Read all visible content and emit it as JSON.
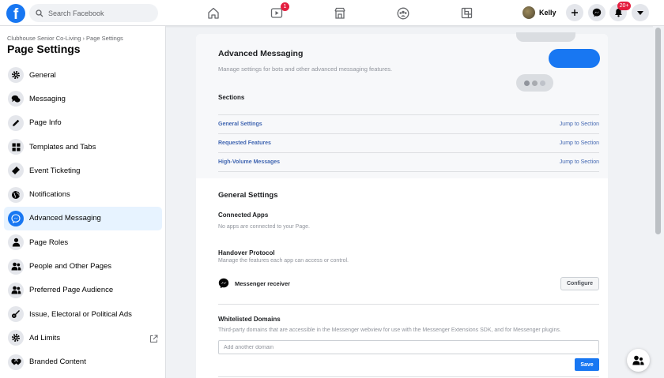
{
  "header": {
    "search_placeholder": "Search Facebook",
    "watch_badge": "1",
    "profile_name": "Kelly",
    "notifications_badge": "20+"
  },
  "sidebar": {
    "breadcrumb": "Clubhouse Senior Co-Living › Page Settings",
    "title": "Page Settings",
    "items": [
      {
        "label": "General",
        "icon": "gear-icon"
      },
      {
        "label": "Messaging",
        "icon": "chat-bubbles-icon"
      },
      {
        "label": "Page Info",
        "icon": "pencil-icon"
      },
      {
        "label": "Templates and Tabs",
        "icon": "grid-icon"
      },
      {
        "label": "Event Ticketing",
        "icon": "ticket-icon"
      },
      {
        "label": "Notifications",
        "icon": "globe-icon"
      },
      {
        "label": "Advanced Messaging",
        "icon": "messenger-icon",
        "active": true
      },
      {
        "label": "Page Roles",
        "icon": "person-icon"
      },
      {
        "label": "People and Other Pages",
        "icon": "people-icon"
      },
      {
        "label": "Preferred Page Audience",
        "icon": "people-icon"
      },
      {
        "label": "Issue, Electoral or Political Ads",
        "icon": "guitar-icon"
      },
      {
        "label": "Ad Limits",
        "icon": "gear-icon",
        "external": true
      },
      {
        "label": "Branded Content",
        "icon": "handshake-icon"
      }
    ]
  },
  "main": {
    "title": "Advanced Messaging",
    "subtitle": "Manage settings for bots and other advanced messaging features.",
    "sections_label": "Sections",
    "sections": [
      {
        "label": "General Settings",
        "jump": "Jump to Section"
      },
      {
        "label": "Requested Features",
        "jump": "Jump to Section"
      },
      {
        "label": "High-Volume Messages",
        "jump": "Jump to Section"
      }
    ],
    "general_settings_title": "General Settings",
    "connected_apps_title": "Connected Apps",
    "connected_apps_desc": "No apps are connected to your Page.",
    "handover_title": "Handover Protocol",
    "handover_desc": "Manage the features each app can access or control.",
    "messenger_receiver": "Messenger receiver",
    "configure_label": "Configure",
    "whitelisted_title": "Whitelisted Domains",
    "whitelisted_desc": "Third-party domains that are accessible in the Messenger webview for use with the Messenger Extensions SDK, and for Messenger plugins.",
    "domain_placeholder": "Add another domain",
    "save_label": "Save"
  },
  "colors": {
    "brand_blue": "#1877f2",
    "link_blue": "#4267b2",
    "badge_red": "#e41e3f"
  }
}
